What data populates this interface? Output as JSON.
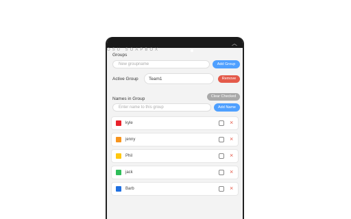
{
  "app": {
    "title": "OSU SOAPBOX",
    "header_ghost_text": "OSU SOAPBOX"
  },
  "groups": {
    "label": "Groups",
    "new_group_placeholder": "New groupname",
    "add_group_label": "Add Group",
    "active_group_label": "Active Group",
    "active_group_value": "Team1",
    "remove_label": "Remove"
  },
  "names": {
    "label": "Names in Group",
    "clear_checked_label": "Clear Checked",
    "new_name_placeholder": "Enter name to this group",
    "add_name_label": "Add Name",
    "members": [
      {
        "name": "kyle",
        "color": "#e8222a"
      },
      {
        "name": "jenny",
        "color": "#f7941d"
      },
      {
        "name": "Phil",
        "color": "#ffc70f"
      },
      {
        "name": "jack",
        "color": "#2ebd59"
      },
      {
        "name": "Barb",
        "color": "#1f6fe0"
      }
    ],
    "delete_glyph": "×"
  },
  "icons": {
    "collapse": "chevron-up-icon"
  }
}
